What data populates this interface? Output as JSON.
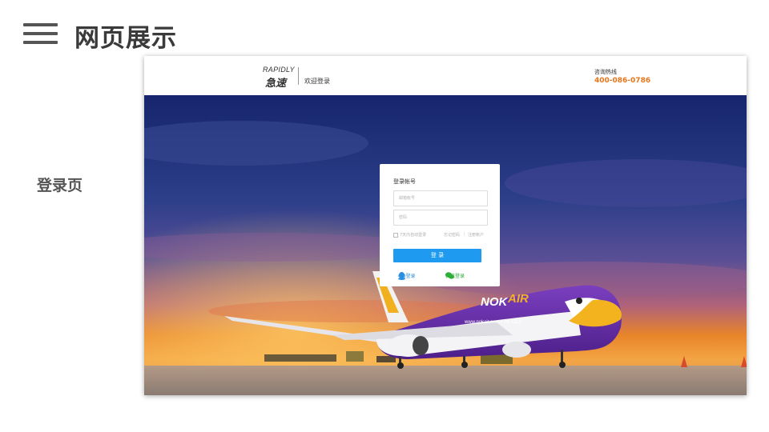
{
  "slide": {
    "title": "网页展示",
    "section_label": "登录页"
  },
  "site_header": {
    "logo_en": "RAPIDLY",
    "logo_cn": "急速",
    "welcome": "欢迎登录",
    "hotline_label": "咨询热线",
    "hotline_number": "400-086-0786"
  },
  "login": {
    "title": "登录帐号",
    "account_placeholder": "邮箱帐号",
    "password_placeholder": "密码",
    "remember_label": "7天内自动登录",
    "forgot_label": "忘记密码",
    "separator": "|",
    "register_label": "注册帐户",
    "submit_label": "登 录",
    "qq_label": "QQ登录",
    "wechat_label": "微信登录"
  },
  "hero": {
    "aircraft_brand": "NOKAIR",
    "aircraft_brand_parts": [
      "NOK",
      "AIR"
    ],
    "aircraft_text": "www.nokair.com • Tel.1318"
  },
  "colors": {
    "accent_blue": "#1e9bf0",
    "hotline_orange": "#e8751a",
    "qq_blue": "#2a8ee0",
    "wechat_green": "#2eae3a",
    "sky_top": "#14246b",
    "sky_sunset": "#e8842a"
  },
  "icons": {
    "menu": "hamburger-menu-icon",
    "qq": "qq-icon",
    "wechat": "wechat-icon"
  }
}
